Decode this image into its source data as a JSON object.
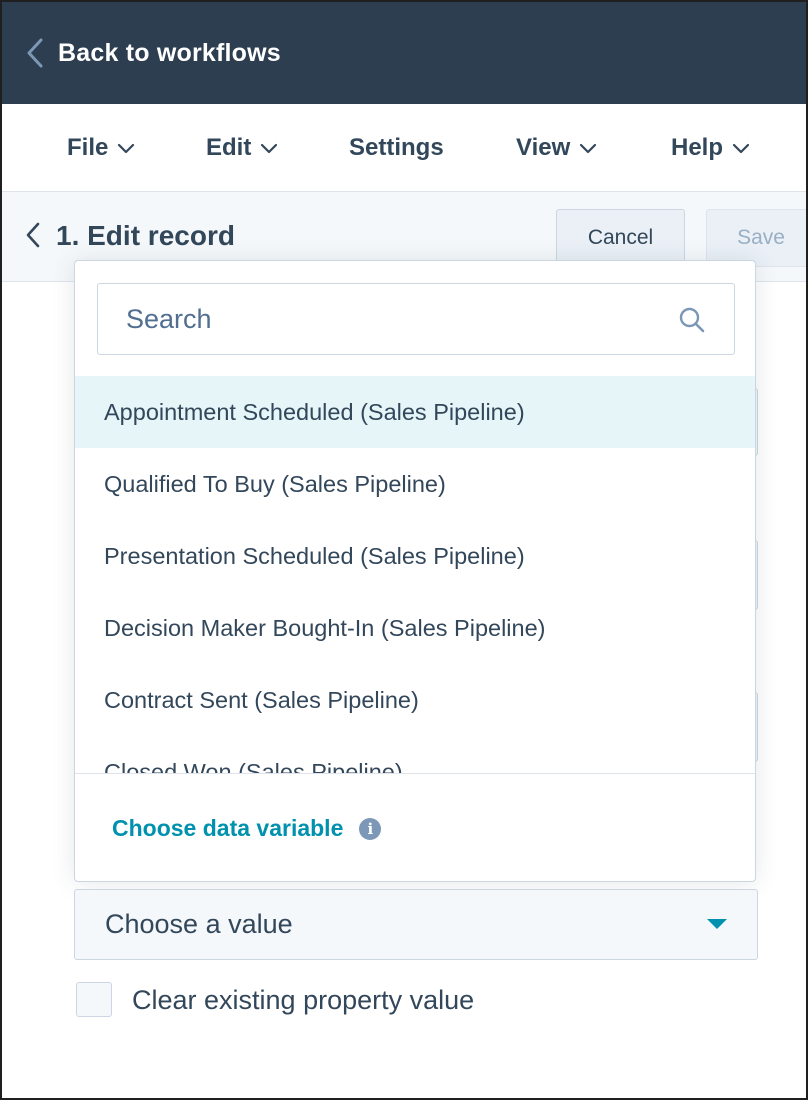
{
  "header": {
    "back_label": "Back to workflows"
  },
  "menu": {
    "file": "File",
    "edit": "Edit",
    "settings": "Settings",
    "view": "View",
    "help": "Help"
  },
  "action": {
    "title": "1. Edit record",
    "cancel_label": "Cancel",
    "save_label": "Save"
  },
  "dropdown": {
    "search_placeholder": "Search",
    "options": [
      "Appointment Scheduled (Sales Pipeline)",
      "Qualified To Buy (Sales Pipeline)",
      "Presentation Scheduled (Sales Pipeline)",
      "Decision Maker Bought-In (Sales Pipeline)",
      "Contract Sent (Sales Pipeline)",
      "Closed Won (Sales Pipeline)"
    ],
    "highlighted_index": 0,
    "footer_link": "Choose data variable",
    "info_glyph": "i"
  },
  "value_select": {
    "placeholder": "Choose a value"
  },
  "clear_option": {
    "label": "Clear existing property value",
    "checked": false
  },
  "colors": {
    "header_bg": "#2d3e50",
    "accent": "#0091ae",
    "highlight": "#e5f5f8",
    "text": "#33475b"
  },
  "icons": {
    "back": "chevron-left-icon",
    "menu_caret": "chevron-down-icon",
    "search": "search-icon",
    "info": "info-icon",
    "select_arrow": "caret-down-icon"
  }
}
